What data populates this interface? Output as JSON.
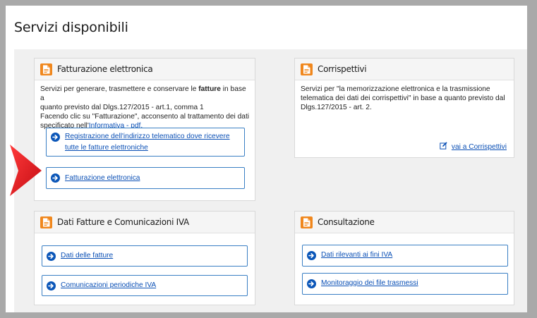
{
  "page": {
    "title": "Servizi disponibili"
  },
  "cards": {
    "fatturazione": {
      "title": "Fatturazione elettronica",
      "desc_line1_before": "Servizi per generare, trasmettere e conservare le ",
      "desc_line1_bold": "fatture",
      "desc_line1_after": " in base a",
      "desc_line2": "quanto previsto dal Dlgs.127/2015 - art.1, comma 1",
      "desc_line3": "Facendo clic su \"Fatturazione\", acconsento al trattamento dei dati",
      "desc_line4_before": "specificato nell'",
      "desc_link": "Informativa - pdf.",
      "btn_registrazione": "Registrazione dell'indirizzo telematico dove ricevere tutte le fatture elettroniche",
      "btn_fatturazione": "Fatturazione elettronica"
    },
    "corrispettivi": {
      "title": "Corrispettivi",
      "desc_line1": "Servizi per \"la memorizzazione elettronica e la trasmissione",
      "desc_line2": "telematica dei dati dei corrispettivi\" in base a quanto previsto dal",
      "desc_line3": "Dlgs.127/2015 - art. 2.",
      "link": "vai a Corrispettivi"
    },
    "dati_fatture": {
      "title": "Dati Fatture e Comunicazioni IVA",
      "btn_dati": "Dati delle fatture",
      "btn_comunicazioni": "Comunicazioni periodiche IVA"
    },
    "consultazione": {
      "title": "Consultazione",
      "btn_dati_iva": "Dati rilevanti ai fini IVA",
      "btn_monitoraggio": "Monitoraggio dei file trasmessi"
    }
  },
  "colors": {
    "accent_orange": "#f0871d",
    "link_blue": "#0a4fb5",
    "button_border": "#3a7fc4",
    "pointer_red": "#e3101b"
  },
  "icons": {
    "card_icon": "document-icon",
    "button_icon": "arrow-right-circle-icon",
    "link_icon": "edit-icon",
    "pointer": "red-pointer-arrow"
  }
}
